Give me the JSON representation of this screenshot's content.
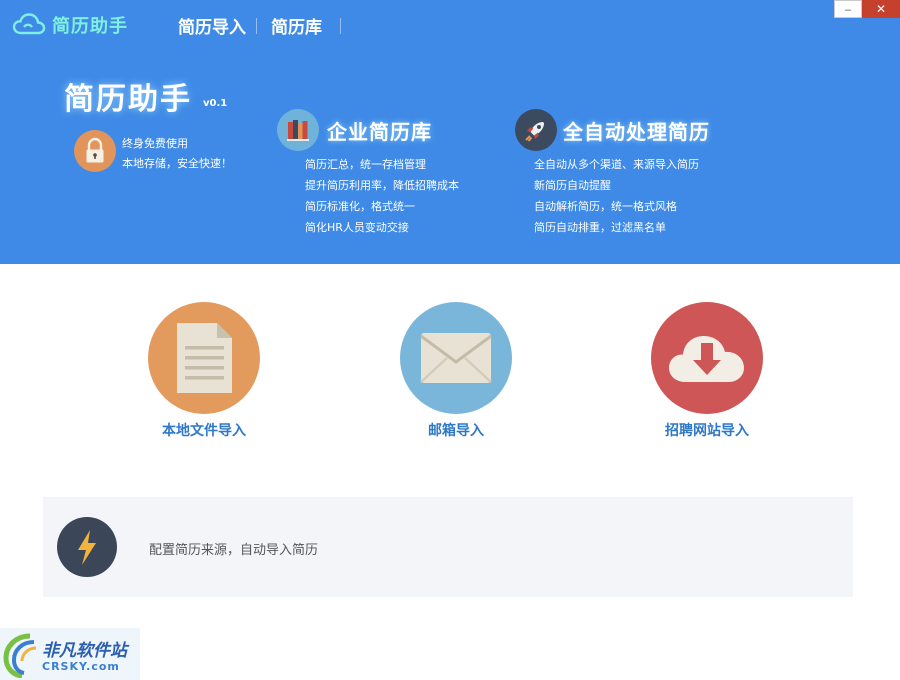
{
  "titlebar": {
    "app_name": "简历助手",
    "nav": [
      "简历导入",
      "简历库"
    ],
    "minimize_symbol": "‒",
    "close_symbol": "✕"
  },
  "hero": {
    "title": "简历助手",
    "version": "v0.1",
    "features": [
      "终身免费使用",
      "本地存储，安全快速！"
    ]
  },
  "sections": [
    {
      "title": "企业简历库",
      "icon": "books-icon",
      "lines": [
        "简历汇总，统一存档管理",
        "提升简历利用率，降低招聘成本",
        "简历标准化，格式统一",
        "简化HR人员变动交接"
      ]
    },
    {
      "title": "全自动处理简历",
      "icon": "rocket-icon",
      "lines": [
        "全自动从多个渠道、来源导入简历",
        "新简历自动提醒",
        "自动解析简历，统一格式风格",
        "简历自动排重，过滤黑名单"
      ]
    }
  ],
  "imports": [
    {
      "label": "本地文件导入",
      "icon": "document-icon",
      "color": "#e39a5d"
    },
    {
      "label": "邮箱导入",
      "icon": "envelope-icon",
      "color": "#7ab6d9"
    },
    {
      "label": "招聘网站导入",
      "icon": "cloud-download-icon",
      "color": "#cf5656"
    }
  ],
  "config": {
    "text": "配置简历来源，自动导入简历",
    "icon": "lightning-icon"
  },
  "watermark": {
    "line1": "非凡软件站",
    "line2": "CRSKY.com"
  }
}
